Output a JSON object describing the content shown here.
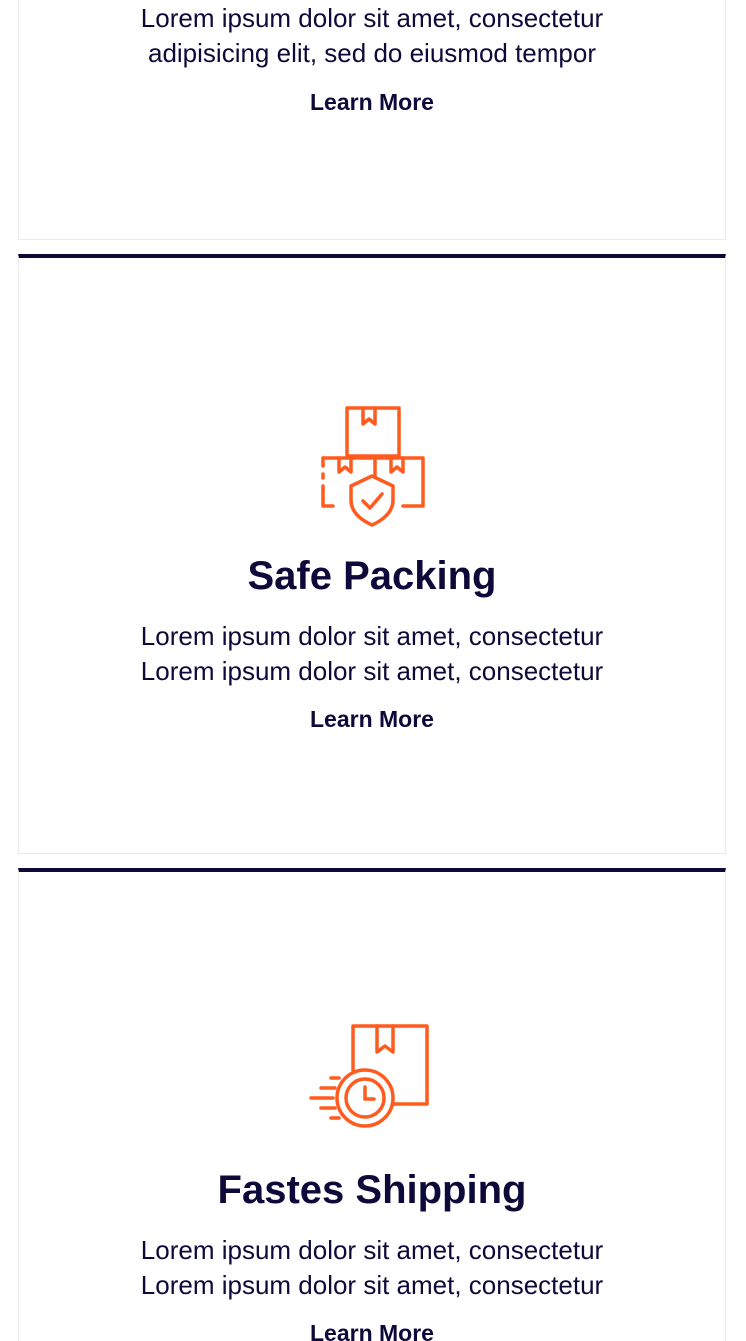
{
  "colors": {
    "accent_icon": "#ff5b1f",
    "text": "#0d0a3a",
    "border_top": "#0d0a3a"
  },
  "cards": [
    {
      "icon": null,
      "title": "",
      "desc_line1": "Lorem ipsum dolor sit amet, consectetur",
      "desc_line2": "adipisicing elit, sed do eiusmod tempor",
      "link": "Learn More"
    },
    {
      "icon": "boxes-shield-icon",
      "title": "Safe Packing",
      "desc_line1": "Lorem ipsum dolor sit amet, consectetur",
      "desc_line2": "Lorem ipsum dolor sit amet, consectetur",
      "link": "Learn More"
    },
    {
      "icon": "fast-delivery-clock-icon",
      "title": "Fastes Shipping",
      "desc_line1": "Lorem ipsum dolor sit amet, consectetur",
      "desc_line2": "Lorem ipsum dolor sit amet, consectetur",
      "link": "Learn More"
    }
  ]
}
